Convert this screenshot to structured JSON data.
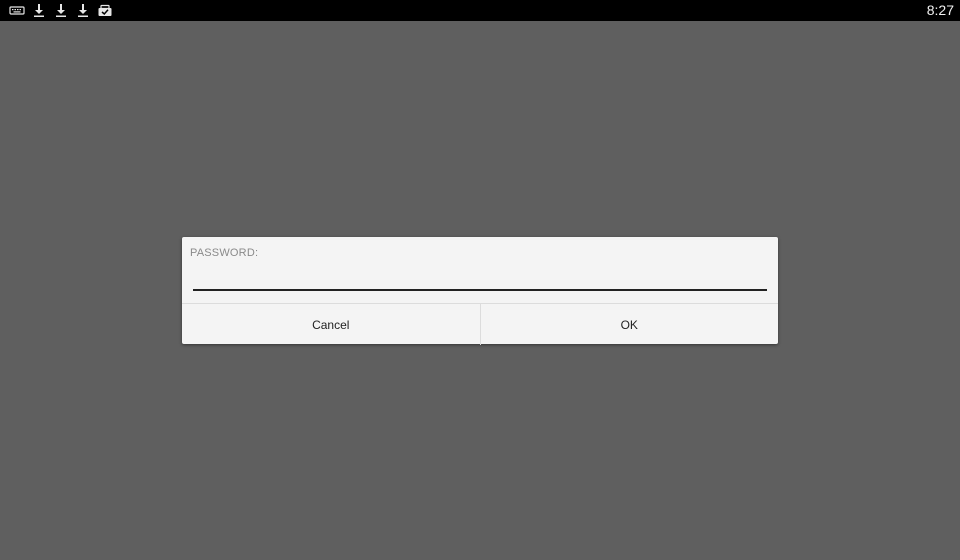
{
  "status_bar": {
    "icons": [
      "keyboard-icon",
      "download-icon",
      "download-icon",
      "download-icon",
      "update-icon"
    ],
    "time": "8:27",
    "background": "#000000",
    "icon_color": "#e6e6e6"
  },
  "scrim_color": "#5f5f5f",
  "dialog": {
    "label": "PASSWORD:",
    "password_value": "",
    "cancel_label": "Cancel",
    "ok_label": "OK",
    "background": "#f4f4f4"
  }
}
